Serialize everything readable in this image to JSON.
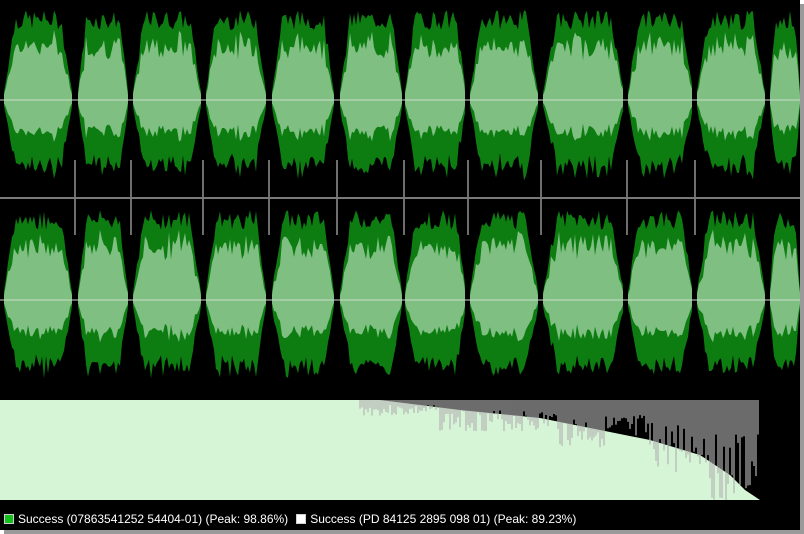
{
  "colors": {
    "background": "#000000",
    "wave_outer": "#0d7d12",
    "wave_inner": "#7fbf82",
    "center_line": "#c9dcc9",
    "marker_line": "#dcdcdc",
    "spectrum_light": "#d6f5d6",
    "spectrum_gray": "#b3b3b3",
    "legend_green": "#12c21c",
    "legend_white": "#ffffff"
  },
  "waveform": {
    "channels": [
      {
        "name": "channel-1"
      },
      {
        "name": "channel-2"
      }
    ],
    "segment_count": 13
  },
  "legend": [
    {
      "label": "Success (07863541252 54404-01) (Peak: 98.86%)",
      "color": "#12c21c"
    },
    {
      "label": "Success (PD 84125 2895 098 01) (Peak: 89.23%)",
      "color": "#ffffff"
    }
  ]
}
